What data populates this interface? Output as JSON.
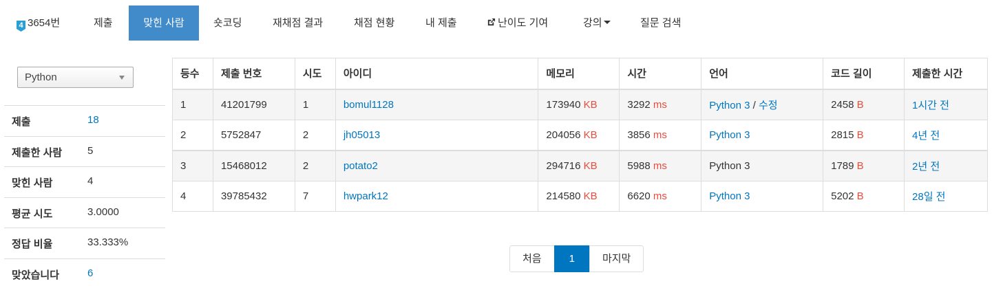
{
  "nav": {
    "problem": "3654번",
    "tier_badge": "4",
    "items": [
      "제출",
      "맞힌 사람",
      "숏코딩",
      "재채점 결과",
      "채점 현황",
      "내 제출",
      "난이도 기여",
      "강의",
      "질문 검색"
    ]
  },
  "filter": {
    "language": "Python"
  },
  "stats": [
    {
      "label": "제출",
      "value": "18"
    },
    {
      "label": "제출한 사람",
      "value": "5"
    },
    {
      "label": "맞힌 사람",
      "value": "4"
    },
    {
      "label": "평균 시도",
      "value": "3.0000"
    },
    {
      "label": "정답 비율",
      "value": "33.333%"
    },
    {
      "label": "맞았습니다",
      "value": "6"
    }
  ],
  "table": {
    "headers": [
      "등수",
      "제출 번호",
      "시도",
      "아이디",
      "메모리",
      "시간",
      "언어",
      "코드 길이",
      "제출한 시간"
    ],
    "rows": [
      {
        "rank": "1",
        "submission": "41201799",
        "tries": "1",
        "user": "bomul1128",
        "memory": "173940",
        "memory_unit": "KB",
        "time": "3292",
        "time_unit": "ms",
        "language": "Python 3",
        "language_extra_sep": " / ",
        "language_extra": "수정",
        "code_length": "2458",
        "code_unit": "B",
        "submitted": "1시간 전"
      },
      {
        "rank": "2",
        "submission": "5752847",
        "tries": "2",
        "user": "jh05013",
        "memory": "204056",
        "memory_unit": "KB",
        "time": "3856",
        "time_unit": "ms",
        "language": "Python 3",
        "code_length": "2815",
        "code_unit": "B",
        "submitted": "4년 전"
      },
      {
        "rank": "3",
        "submission": "15468012",
        "tries": "2",
        "user": "potato2",
        "memory": "294716",
        "memory_unit": "KB",
        "time": "5988",
        "time_unit": "ms",
        "language": "Python 3",
        "code_length": "1789",
        "code_unit": "B",
        "submitted": "2년 전"
      },
      {
        "rank": "4",
        "submission": "39785432",
        "tries": "7",
        "user": "hwpark12",
        "memory": "214580",
        "memory_unit": "KB",
        "time": "6620",
        "time_unit": "ms",
        "language": "Python 3",
        "code_length": "5202",
        "code_unit": "B",
        "submitted": "28일 전"
      }
    ]
  },
  "pagination": {
    "first": "처음",
    "current": "1",
    "last": "마지막"
  },
  "colors": {
    "accent": "#428bca",
    "link": "#0076c0",
    "unit": "#e74c3c"
  }
}
